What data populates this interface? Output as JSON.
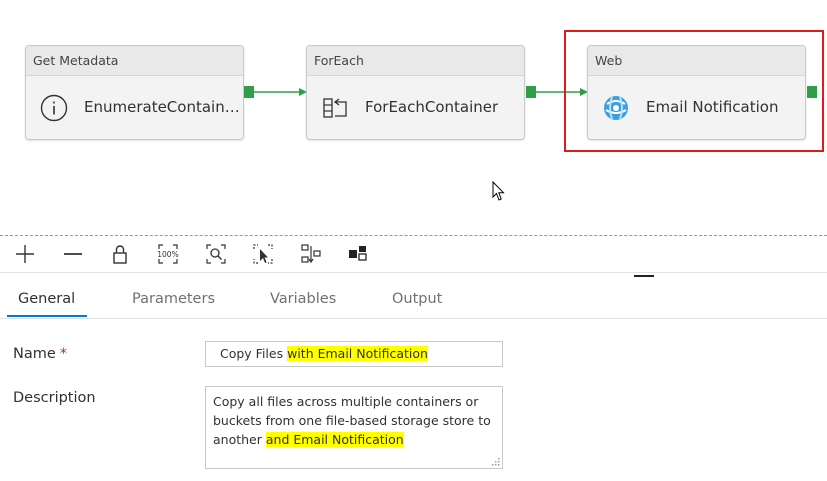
{
  "pipeline": {
    "nodes": [
      {
        "type_label": "Get Metadata",
        "name": "EnumerateContainers...",
        "icon": "info-icon"
      },
      {
        "type_label": "ForEach",
        "name": "ForEachContainer",
        "icon": "foreach-icon"
      },
      {
        "type_label": "Web",
        "name": "Email Notification",
        "icon": "web-globe-icon"
      }
    ],
    "port_color": "#2e9e48",
    "selection_color": "#e01b1b"
  },
  "toolbar": {
    "buttons": [
      "add-icon",
      "remove-icon",
      "lock-icon",
      "zoom-100-icon",
      "zoom-fit-icon",
      "select-icon",
      "auto-align-icon",
      "layout-icon"
    ],
    "zoom_100_text": "100%"
  },
  "tabs": [
    {
      "label": "General",
      "active": true
    },
    {
      "label": "Parameters",
      "active": false
    },
    {
      "label": "Variables",
      "active": false
    },
    {
      "label": "Output",
      "active": false
    }
  ],
  "general": {
    "name_label": "Name",
    "required_mark": "*",
    "name_value_plain": "Copy Files ",
    "name_value_highlight": "with Email Notification",
    "description_label": "Description",
    "description_plain": "Copy all files across multiple containers or buckets from one file-based storage store to another ",
    "description_highlight": "and Email Notification",
    "highlight_color": "#ffff00",
    "accent_color": "#0078d4"
  }
}
